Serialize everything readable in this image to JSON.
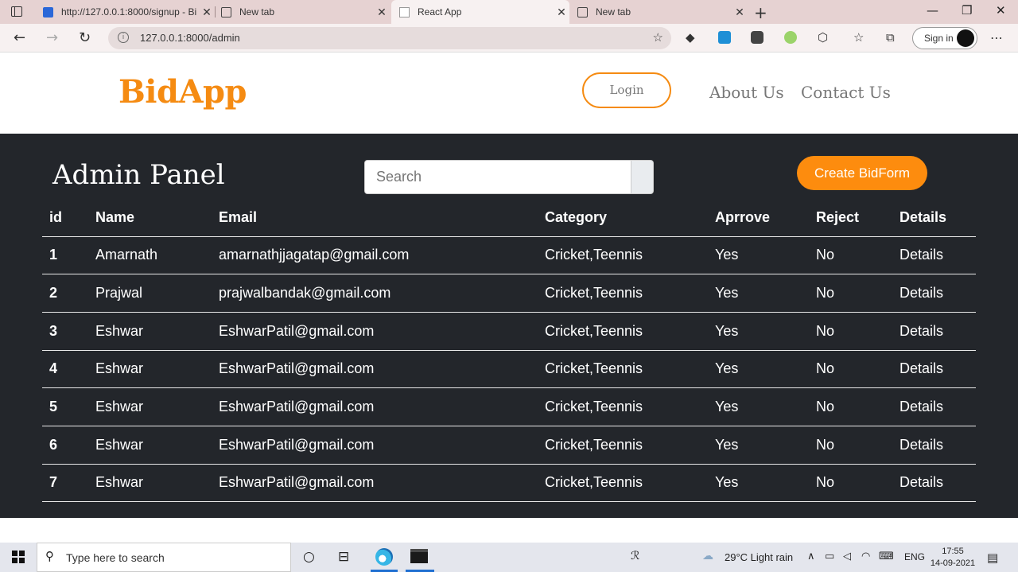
{
  "browser": {
    "tabs": [
      {
        "title": "http://127.0.0.1:8000/signup - Bi"
      },
      {
        "title": "New tab"
      },
      {
        "title": "React App"
      },
      {
        "title": "New tab"
      }
    ],
    "url": "127.0.0.1:8000/admin",
    "signin_label": "Sign in"
  },
  "site": {
    "logo": "BidApp",
    "login_label": "Login",
    "nav": [
      "About Us",
      "Contact Us"
    ]
  },
  "admin": {
    "title": "Admin Panel",
    "search_placeholder": "Search",
    "create_label": "Create BidForm",
    "columns": [
      "id",
      "Name",
      "Email",
      "Category",
      "Aprrove",
      "Reject",
      "Details"
    ],
    "rows": [
      {
        "id": "1",
        "name": "Amarnath",
        "email": "amarnathjjagatap@gmail.com",
        "category": "Cricket,Teennis",
        "approve": "Yes",
        "reject": "No",
        "details": "Details"
      },
      {
        "id": "2",
        "name": "Prajwal",
        "email": "prajwalbandak@gmail.com",
        "category": "Cricket,Teennis",
        "approve": "Yes",
        "reject": "No",
        "details": "Details"
      },
      {
        "id": "3",
        "name": "Eshwar",
        "email": "EshwarPatil@gmail.com",
        "category": "Cricket,Teennis",
        "approve": "Yes",
        "reject": "No",
        "details": "Details"
      },
      {
        "id": "4",
        "name": "Eshwar",
        "email": "EshwarPatil@gmail.com",
        "category": "Cricket,Teennis",
        "approve": "Yes",
        "reject": "No",
        "details": "Details"
      },
      {
        "id": "5",
        "name": "Eshwar",
        "email": "EshwarPatil@gmail.com",
        "category": "Cricket,Teennis",
        "approve": "Yes",
        "reject": "No",
        "details": "Details"
      },
      {
        "id": "6",
        "name": "Eshwar",
        "email": "EshwarPatil@gmail.com",
        "category": "Cricket,Teennis",
        "approve": "Yes",
        "reject": "No",
        "details": "Details"
      },
      {
        "id": "7",
        "name": "Eshwar",
        "email": "EshwarPatil@gmail.com",
        "category": "Cricket,Teennis",
        "approve": "Yes",
        "reject": "No",
        "details": "Details"
      }
    ]
  },
  "taskbar": {
    "search_placeholder": "Type here to search",
    "weather": "29°C  Light rain",
    "lang": "ENG",
    "time": "17:55",
    "date": "14-09-2021"
  },
  "colors": {
    "brand": "#f58b12",
    "panel_bg": "#23262b"
  }
}
